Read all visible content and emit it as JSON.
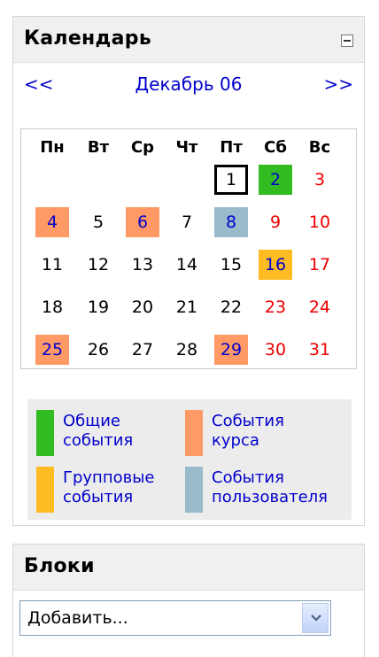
{
  "calendar": {
    "title": "Календарь",
    "nav": {
      "prev": "<<",
      "month": "Декабрь 06",
      "next": ">>"
    },
    "weekdays": [
      "Пн",
      "Вт",
      "Ср",
      "Чт",
      "Пт",
      "Сб",
      "Вс"
    ],
    "weeks": [
      [
        "",
        "",
        "",
        "",
        "1",
        "2",
        "3"
      ],
      [
        "4",
        "5",
        "6",
        "7",
        "8",
        "9",
        "10"
      ],
      [
        "11",
        "12",
        "13",
        "14",
        "15",
        "16",
        "17"
      ],
      [
        "18",
        "19",
        "20",
        "21",
        "22",
        "23",
        "24"
      ],
      [
        "25",
        "26",
        "27",
        "28",
        "29",
        "30",
        "31"
      ]
    ],
    "today": "1",
    "events": {
      "global": [
        "2"
      ],
      "course": [
        "4",
        "6",
        "25",
        "29"
      ],
      "user": [
        "8"
      ],
      "group": [
        "16"
      ]
    },
    "legend": [
      {
        "key": "global",
        "line1": "Общие",
        "line2": "события"
      },
      {
        "key": "course",
        "line1": "События",
        "line2": "курса"
      },
      {
        "key": "group",
        "line1": "Групповые",
        "line2": "события"
      },
      {
        "key": "user",
        "line1": "События",
        "line2": "пользователя"
      }
    ]
  },
  "blocks": {
    "title": "Блоки",
    "add_select_value": "Добавить..."
  },
  "colors": {
    "global": "#33bb22",
    "course": "#ff9966",
    "group": "#ffbb22",
    "user": "#99bbcc",
    "weekend": "#ee0000",
    "link": "#0000cc"
  }
}
